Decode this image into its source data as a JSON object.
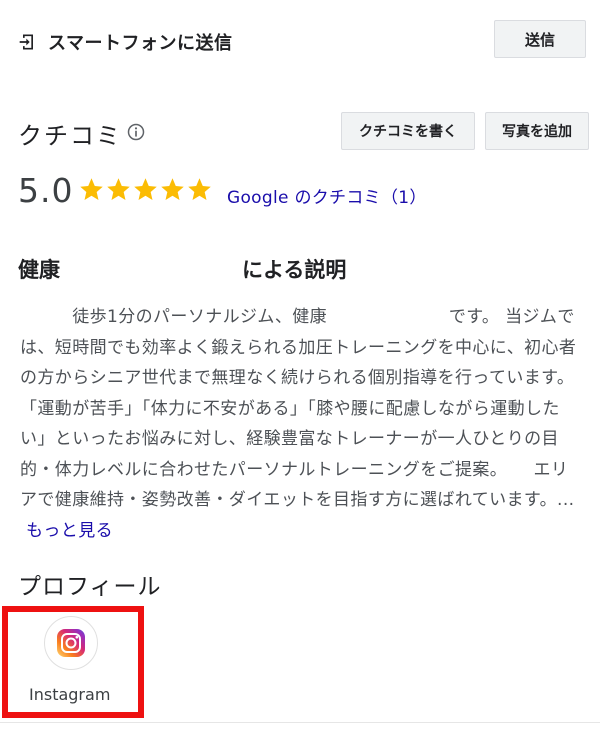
{
  "send_to_phone": {
    "label": "スマートフォンに送信",
    "button_label": "送信",
    "icon": "send-to-device-icon"
  },
  "reviews": {
    "title": "クチコミ",
    "info_icon": "info-icon",
    "write_button": "クチコミを書く",
    "add_photo_button": "写真を追加",
    "rating": "5.0",
    "stars": 5,
    "star_color": "#fbbc04",
    "link_text": "Google のクチコミ（1）"
  },
  "description": {
    "heading_part1": "健康",
    "heading_part2": "による説明",
    "text": "　　　徒歩1分のパーソナルジム、健康　　　　　　　です。 当ジムでは、短時間でも効率よく鍛えられる加圧トレーニングを中心に、初心者の方からシニア世代まで無理なく続けられる個別指導を行っています。 「運動が苦手」「体力に不安がある」「膝や腰に配慮しながら運動したい」といったお悩みに対し、経験豊富なトレーナーが一人ひとりの目的・体力レベルに合わせたパーソナルトレーニングをご提案。　　エリアで健康維持・姿勢改善・ダイエットを目指す方に選ばれています。...",
    "more_link": "もっと見る"
  },
  "profile": {
    "heading": "プロフィール",
    "items": [
      {
        "label": "Instagram",
        "icon": "instagram-icon"
      }
    ],
    "highlight_color": "#ee1111"
  },
  "colors": {
    "link": "#1a0dab",
    "button_bg": "#f1f3f4",
    "text": "#202124"
  }
}
